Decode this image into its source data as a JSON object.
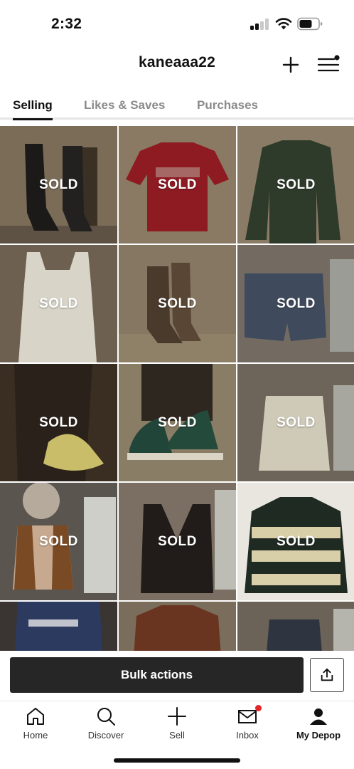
{
  "status_bar": {
    "time": "2:32"
  },
  "header": {
    "username": "kaneaaa22",
    "add_icon": "plus-icon",
    "menu_icon": "hamburger-menu-icon"
  },
  "tabs": [
    {
      "label": "Selling",
      "active": true
    },
    {
      "label": "Likes & Saves",
      "active": false
    },
    {
      "label": "Purchases",
      "active": false
    }
  ],
  "listings": [
    {
      "item": "black heeled boots",
      "badge": "SOLD"
    },
    {
      "item": "red Harvard t-shirt",
      "badge": "SOLD"
    },
    {
      "item": "green Hollister henley",
      "badge": "SOLD"
    },
    {
      "item": "white graphic tank top",
      "badge": "SOLD"
    },
    {
      "item": "brown western boots",
      "badge": "SOLD"
    },
    {
      "item": "denim shorts",
      "badge": "SOLD"
    },
    {
      "item": "yellow shoulder bag",
      "badge": "SOLD"
    },
    {
      "item": "green high-top sneakers",
      "badge": "SOLD"
    },
    {
      "item": "white denim mini skirt",
      "badge": "SOLD"
    },
    {
      "item": "brown fur-hood vest",
      "badge": "SOLD"
    },
    {
      "item": "black leather vest",
      "badge": "SOLD"
    },
    {
      "item": "striped rugby shirt",
      "badge": "SOLD"
    },
    {
      "item": "navy Cowboys tee",
      "badge": ""
    },
    {
      "item": "brown sweatshirt",
      "badge": ""
    },
    {
      "item": "dark denim skirt",
      "badge": ""
    }
  ],
  "bulk_actions": {
    "label": "Bulk actions",
    "share_icon": "share-icon"
  },
  "bottom_nav": [
    {
      "label": "Home",
      "icon": "home-icon",
      "active": false
    },
    {
      "label": "Discover",
      "icon": "search-icon",
      "active": false
    },
    {
      "label": "Sell",
      "icon": "plus-icon",
      "active": false
    },
    {
      "label": "Inbox",
      "icon": "mail-icon",
      "active": false,
      "notification": true
    },
    {
      "label": "My Depop",
      "icon": "profile-icon",
      "active": true
    }
  ],
  "colors": {
    "accent": "#262626",
    "notification": "#e3262a",
    "muted_tab": "#8a8a8a"
  }
}
